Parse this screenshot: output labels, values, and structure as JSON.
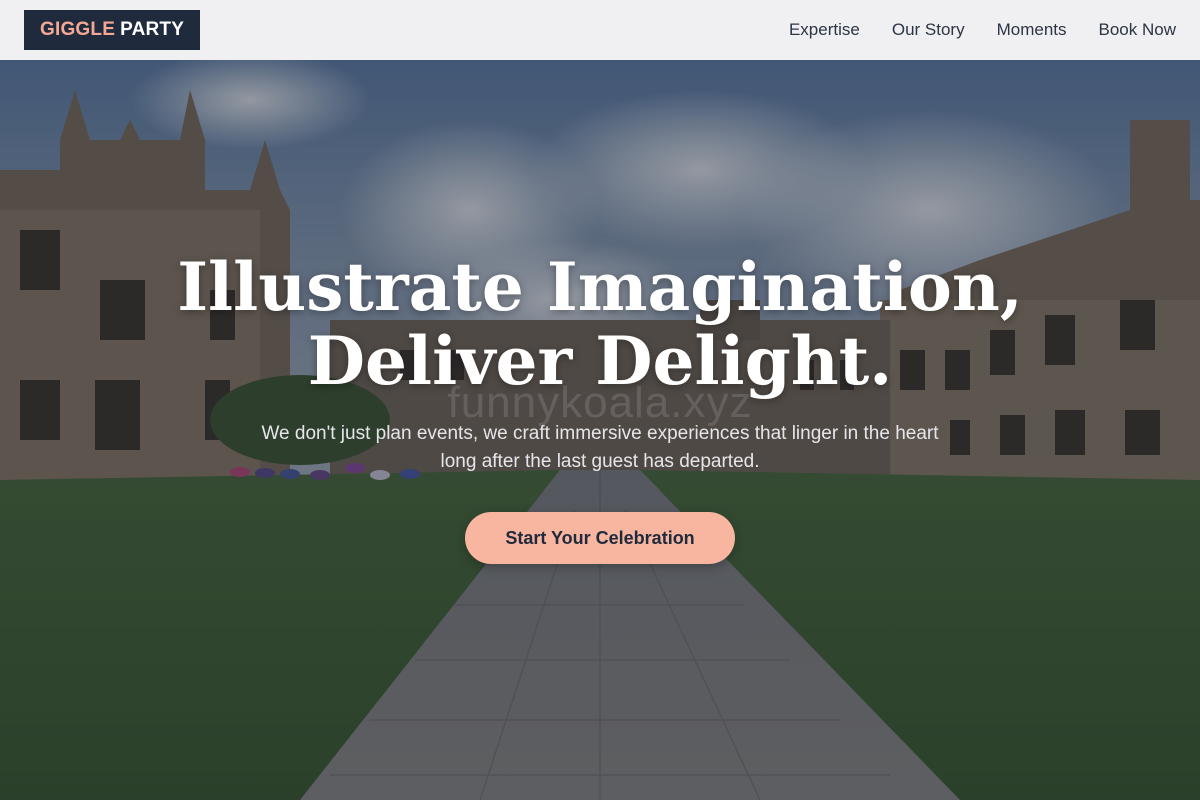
{
  "brand": {
    "part1": "GIGGLE",
    "part2": "PARTY"
  },
  "nav": {
    "items": [
      {
        "label": "Expertise"
      },
      {
        "label": "Our Story"
      },
      {
        "label": "Moments"
      },
      {
        "label": "Book Now"
      }
    ]
  },
  "hero": {
    "title_line1": "Illustrate Imagination,",
    "title_line2": "Deliver Delight.",
    "subtitle": "We don't just plan events, we craft immersive experiences that linger in the heart long after the last guest has departed.",
    "cta_label": "Start Your Celebration",
    "watermark": "funnykoala.xyz"
  },
  "colors": {
    "navbar_bg": "#f0eff2",
    "logo_bg": "#1f2a3c",
    "logo_accent": "#f5a994",
    "cta_bg": "#f8b5a0",
    "text_dark": "#2c3544"
  },
  "background_image": {
    "description_icon": "university-quad-photo"
  }
}
